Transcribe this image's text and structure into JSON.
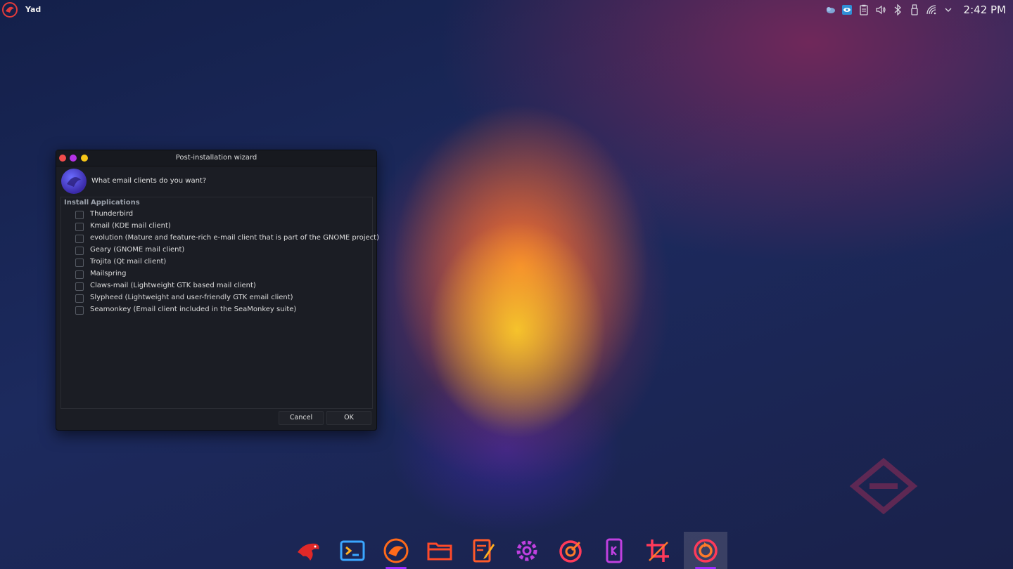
{
  "topbar": {
    "app_name": "Yad",
    "clock": "2:42 PM",
    "tray_icons": [
      "weather-icon",
      "screen-share-icon",
      "clipboard-icon",
      "volume-icon",
      "bluetooth-icon",
      "usb-icon",
      "wifi-icon",
      "tray-expand-icon"
    ]
  },
  "window": {
    "title": "Post-installation wizard",
    "question": "What email clients do you want?",
    "columns": {
      "install": "Install",
      "applications": "Applications"
    },
    "items": [
      {
        "label": "Thunderbird",
        "checked": false
      },
      {
        "label": "Kmail (KDE mail client)",
        "checked": false
      },
      {
        "label": "evolution (Mature and feature-rich e-mail client that is part of the GNOME project)",
        "checked": false
      },
      {
        "label": "Geary (GNOME mail client)",
        "checked": false
      },
      {
        "label": "Trojita (Qt mail client)",
        "checked": false
      },
      {
        "label": "Mailspring",
        "checked": false
      },
      {
        "label": "Claws-mail (Lightweight GTK based mail client)",
        "checked": false
      },
      {
        "label": "Slypheed (Lightweight and user-friendly GTK email client)",
        "checked": false
      },
      {
        "label": "Seamonkey (Email client included in the SeaMonkey suite)",
        "checked": false
      }
    ],
    "cancel_label": "Cancel",
    "ok_label": "OK"
  },
  "dock": {
    "items": [
      "garuda-eagle-icon",
      "terminal-icon",
      "garuda-assistant-icon",
      "file-manager-icon",
      "text-editor-icon",
      "settings-icon",
      "system-monitor-icon",
      "kde-connect-icon",
      "screenshot-crop-icon",
      "garuda-boot-options-icon"
    ],
    "accent_color": "#9b2bff"
  },
  "colors": {
    "window_bg": "#1b1d24",
    "close": "#f24c4c",
    "minimize": "#b533e6",
    "maximize": "#f5c518"
  }
}
